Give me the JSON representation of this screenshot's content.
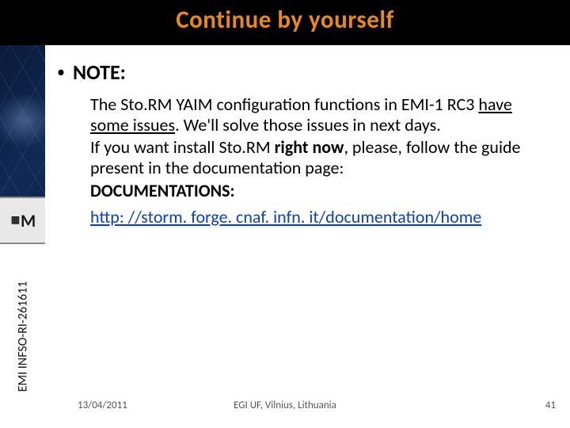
{
  "title": "Continue by yourself",
  "sidebar": {
    "emblem_symbol": "M",
    "vertical_label": "EMI INFSO-RI-261611"
  },
  "note": {
    "heading": "NOTE:",
    "para1_pre": "The Sto.RM YAIM configuration functions in EMI-1 RC3 ",
    "para1_underlined": "have some issues",
    "para1_post": ". We'll solve those issues in next days.",
    "para2_pre": "If you want install Sto.RM ",
    "para2_bold": "right now",
    "para2_post": ", please, follow the guide present in the documentation page:",
    "doc_label": "DOCUMENTATIONS:",
    "link_text": "http: //storm. forge. cnaf. infn. it/documentation/home"
  },
  "footer": {
    "date": "13/04/2011",
    "venue": "EGI UF, Vilnius, Lithuania",
    "page": "41"
  }
}
